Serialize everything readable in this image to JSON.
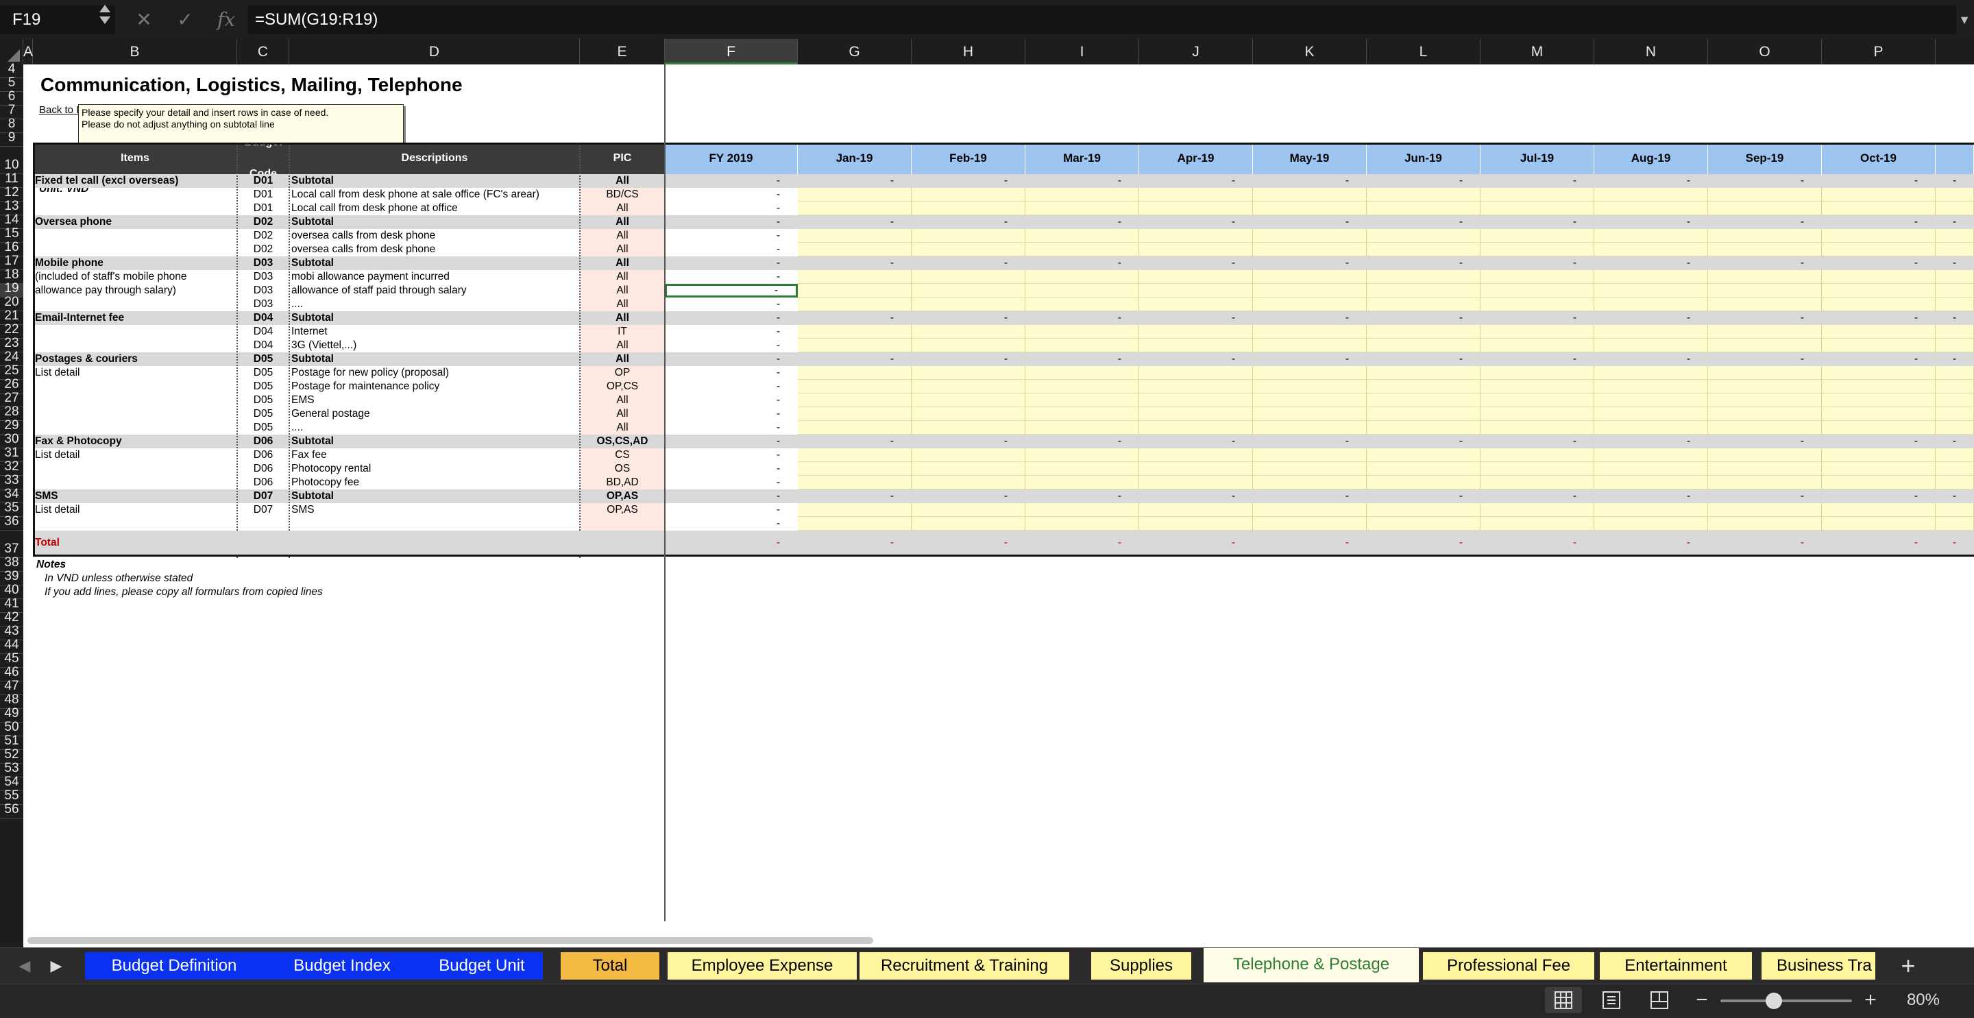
{
  "formula_bar": {
    "name_box": "F19",
    "formula": "=SUM(G19:R19)",
    "cancel_icon": "✕",
    "enter_icon": "✓",
    "fx_label": "fx"
  },
  "columns": [
    "A",
    "B",
    "C",
    "D",
    "E",
    "F",
    "G",
    "H",
    "I",
    "J",
    "K",
    "L",
    "M",
    "N",
    "O",
    "P"
  ],
  "selected_column": "F",
  "rows": [
    "4",
    "5",
    "6",
    "7",
    "8",
    "9",
    "10",
    "11",
    "12",
    "13",
    "14",
    "15",
    "16",
    "17",
    "18",
    "19",
    "20",
    "21",
    "22",
    "23",
    "24",
    "25",
    "26",
    "27",
    "28",
    "29",
    "30",
    "31",
    "32",
    "33",
    "34",
    "35",
    "36",
    "37",
    "38",
    "39",
    "40",
    "41",
    "42",
    "43",
    "44",
    "45",
    "46",
    "47",
    "48",
    "49",
    "50",
    "51",
    "52",
    "53",
    "54",
    "55",
    "56"
  ],
  "selected_row": "19",
  "sheet": {
    "title": "Communication, Logistics, Mailing, Telephone",
    "back_link": "Back to Index",
    "note_box": [
      "Please specify your detail and insert rows in case of need.",
      "Please do not adjust anything on subtotal line"
    ],
    "unit": "Unit: VND",
    "headers": {
      "items": "Items",
      "budget_code": "Budget Code",
      "descriptions": "Descriptions",
      "pic": "PIC",
      "fy": "FY 2019"
    },
    "months": [
      "Jan-19",
      "Feb-19",
      "Mar-19",
      "Apr-19",
      "May-19",
      "Jun-19",
      "Jul-19",
      "Aug-19",
      "Sep-19",
      "Oct-19"
    ],
    "data_rows": [
      {
        "r": "11",
        "items": "Fixed tel call (excl overseas)",
        "code": "D01",
        "desc": "Subtotal",
        "pic": "All",
        "fy": "-",
        "subtotal": true
      },
      {
        "r": "12",
        "items": "",
        "code": "D01",
        "desc": "Local call from desk phone at sale office (FC's arear)",
        "pic": "BD/CS",
        "fy": "-",
        "subtotal": false
      },
      {
        "r": "13",
        "items": "",
        "code": "D01",
        "desc": "Local call from desk phone at office",
        "pic": "All",
        "fy": "-",
        "subtotal": false
      },
      {
        "r": "14",
        "items": "Oversea phone",
        "code": "D02",
        "desc": "Subtotal",
        "pic": "All",
        "fy": "-",
        "subtotal": true
      },
      {
        "r": "15",
        "items": "",
        "code": "D02",
        "desc": "oversea calls from desk phone",
        "pic": "All",
        "fy": "-",
        "subtotal": false
      },
      {
        "r": "16",
        "items": "",
        "code": "D02",
        "desc": "oversea calls from desk phone",
        "pic": "All",
        "fy": "-",
        "subtotal": false
      },
      {
        "r": "17",
        "items": "Mobile phone",
        "code": "D03",
        "desc": "Subtotal",
        "pic": "All",
        "fy": "-",
        "subtotal": true
      },
      {
        "r": "18",
        "items": "(included of staff's mobile phone",
        "code": "D03",
        "desc": "mobi allowance payment incurred",
        "pic": "All",
        "fy": "-",
        "subtotal": false
      },
      {
        "r": "19",
        "items": "allowance pay through salary)",
        "code": "D03",
        "desc": "allowance of staff paid through salary",
        "pic": "All",
        "fy": "-",
        "subtotal": false
      },
      {
        "r": "20",
        "items": "",
        "code": "D03",
        "desc": "....",
        "pic": "All",
        "fy": "-",
        "subtotal": false
      },
      {
        "r": "21",
        "items": "Email-Internet fee",
        "code": "D04",
        "desc": "Subtotal",
        "pic": "All",
        "fy": "-",
        "subtotal": true
      },
      {
        "r": "22",
        "items": "",
        "code": "D04",
        "desc": "Internet",
        "pic": "IT",
        "fy": "-",
        "subtotal": false
      },
      {
        "r": "23",
        "items": "",
        "code": "D04",
        "desc": "3G (Viettel,...)",
        "pic": "All",
        "fy": "-",
        "subtotal": false
      },
      {
        "r": "24",
        "items": "Postages & couriers",
        "code": "D05",
        "desc": "Subtotal",
        "pic": "All",
        "fy": "-",
        "subtotal": true
      },
      {
        "r": "25",
        "items": "List detail",
        "code": "D05",
        "desc": "Postage for new policy (proposal)",
        "pic": "OP",
        "fy": "-",
        "subtotal": false
      },
      {
        "r": "26",
        "items": "",
        "code": "D05",
        "desc": "Postage for maintenance policy",
        "pic": "OP,CS",
        "fy": "-",
        "subtotal": false
      },
      {
        "r": "27",
        "items": "",
        "code": "D05",
        "desc": "EMS",
        "pic": "All",
        "fy": "-",
        "subtotal": false
      },
      {
        "r": "28",
        "items": "",
        "code": "D05",
        "desc": "General postage",
        "pic": "All",
        "fy": "-",
        "subtotal": false
      },
      {
        "r": "29",
        "items": "",
        "code": "D05",
        "desc": "....",
        "pic": "All",
        "fy": "-",
        "subtotal": false
      },
      {
        "r": "30",
        "items": "Fax & Photocopy",
        "code": "D06",
        "desc": "Subtotal",
        "pic": "OS,CS,AD",
        "fy": "-",
        "subtotal": true
      },
      {
        "r": "31",
        "items": "List detail",
        "code": "D06",
        "desc": "Fax fee",
        "pic": "CS",
        "fy": "-",
        "subtotal": false
      },
      {
        "r": "32",
        "items": "",
        "code": "D06",
        "desc": "Photocopy rental",
        "pic": "OS",
        "fy": "-",
        "subtotal": false
      },
      {
        "r": "33",
        "items": "",
        "code": "D06",
        "desc": "Photocopy fee",
        "pic": "BD,AD",
        "fy": "-",
        "subtotal": false
      },
      {
        "r": "34",
        "items": "SMS",
        "code": "D07",
        "desc": "Subtotal",
        "pic": "OP,AS",
        "fy": "-",
        "subtotal": true
      },
      {
        "r": "35",
        "items": "List detail",
        "code": "D07",
        "desc": "SMS",
        "pic": "OP,AS",
        "fy": "-",
        "subtotal": false
      },
      {
        "r": "36",
        "items": "",
        "code": "",
        "desc": "",
        "pic": "",
        "fy": "-",
        "subtotal": false
      }
    ],
    "total_label": "Total",
    "total_value": "-",
    "subtotal_month_value": "-",
    "notes_title": "Notes",
    "notes": [
      "In VND unless otherwise stated",
      "If you add lines, please copy all formulars from copied lines"
    ]
  },
  "tabs": [
    {
      "label": "Budget Definition",
      "style": "blue"
    },
    {
      "label": "Budget Index",
      "style": "blue"
    },
    {
      "label": "Budget Unit",
      "style": "blue"
    },
    {
      "label": "Total",
      "style": "orange"
    },
    {
      "label": "Employee Expense",
      "style": "yellow"
    },
    {
      "label": "Recruitment & Training",
      "style": "yellow"
    },
    {
      "label": "Supplies",
      "style": "yellow"
    },
    {
      "label": "Telephone & Postage",
      "style": "active"
    },
    {
      "label": "Professional Fee",
      "style": "yellow"
    },
    {
      "label": "Entertainment",
      "style": "yellow"
    },
    {
      "label": "Business Tra",
      "style": "yellow"
    }
  ],
  "status_bar": {
    "zoom": "80%"
  },
  "colors": {
    "accent_green": "#2e7d32",
    "tab_blue": "#0b32f2",
    "tab_orange": "#f4b942",
    "tab_yellow": "#fff59d",
    "month_header": "#9ec5ef",
    "input_yellow": "#fffccf"
  }
}
